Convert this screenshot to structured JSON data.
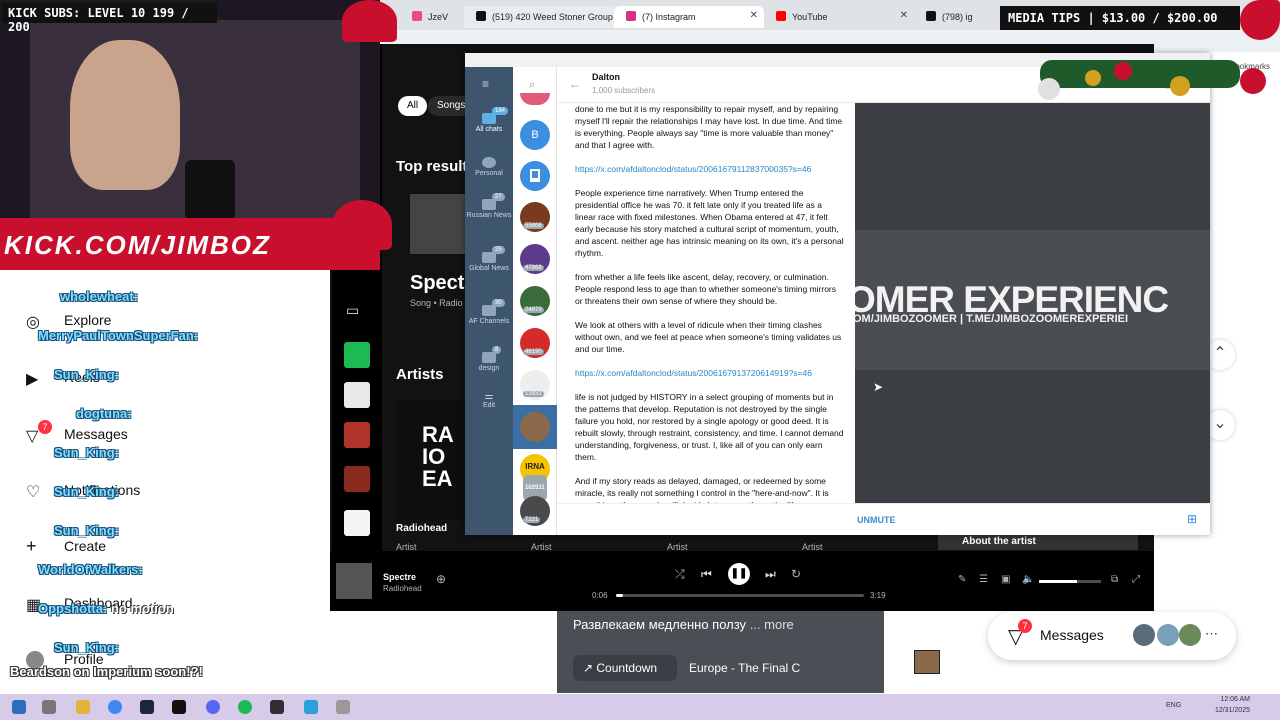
{
  "overlay": {
    "kick_subs": "KICK SUBS: LEVEL 10 199 / 200",
    "media_tips": "MEDIA TIPS | $13.00 / $200.00",
    "banner_url": "KICK.COM/JIMBOZ",
    "chat": [
      {
        "user": "wholewheat:"
      },
      {
        "user": "MerryPaulTownSuperFan:"
      },
      {
        "user": "Sun_King:"
      },
      {
        "user": "dogtuna:"
      },
      {
        "user": "Sun_King:"
      },
      {
        "user": "Sun_King:"
      },
      {
        "user": "Sun_King:"
      },
      {
        "user": "WorldOfWalkers:"
      },
      {
        "user": "Oppshotta:",
        "text": "no motion"
      },
      {
        "user": "Sun_King:"
      },
      {
        "user": "Beardson on Imperium soon!?!"
      }
    ],
    "side_menu": {
      "explore": "Explore",
      "reels": "Reels",
      "messages": "Messages",
      "messages_badge": "7",
      "notifications": "Notifications",
      "create": "Create",
      "dashboard": "Dashboard",
      "profile": "Profile"
    }
  },
  "browser": {
    "tabs": [
      {
        "label": "JzeV",
        "icon_color": "#e94e77"
      },
      {
        "label": "(519) 420 Weed Stoner Group",
        "icon": "x-icon"
      },
      {
        "label": "(7) Instagram",
        "icon": "instagram-icon"
      },
      {
        "label": "YouTube",
        "icon": "youtube-icon"
      },
      {
        "label": "(798) ig",
        "icon": "x-icon"
      }
    ],
    "bookmarks_label": "All Bookmarks"
  },
  "spotify": {
    "chips": [
      "All",
      "Songs"
    ],
    "top_result_heading": "Top result",
    "top_result_title": "Spect",
    "top_result_sub": "Song • Radio",
    "artists_heading": "Artists",
    "artist_card_text": "RA IO EA",
    "artist_name": "Radiohead",
    "artist_labels": [
      "Artist",
      "Artist",
      "Artist",
      "Artist",
      "Artist"
    ],
    "about_artist": "About the artist",
    "player": {
      "track": "Spectre",
      "artist": "Radiohead",
      "elapsed": "0:06",
      "duration": "3:19",
      "progress": 0.03
    }
  },
  "telegram": {
    "channel_name": "Dalton",
    "subscribers": "1,000 subscribers",
    "unmute": "UNMUTE",
    "folders": [
      {
        "label": "All chats",
        "badge": "184"
      },
      {
        "label": "Personal"
      },
      {
        "label": "Russian News",
        "badge": "27"
      },
      {
        "label": "Global News",
        "badge": "25"
      },
      {
        "label": "AF Channels",
        "badge": "30"
      },
      {
        "label": "design",
        "badge": "8"
      },
      {
        "label": "Edit"
      }
    ],
    "chat_badges": [
      "55806",
      "47868",
      "24873",
      "46190",
      "13931",
      "102511",
      "7221"
    ],
    "message": [
      "done to me but it is my responsibility to repair myself, and by repairing myself I'll repair the relationships I may have lost. In due time. And time is everything. People always say \"time is more valuable than money\" and that I agree with.",
      "https://x.com/afdaltonclod/status/2006167911283700035?s=46",
      "People experience time narratively. When Trump entered the presidential office he was 70. it felt late only if you treated life as a linear race with fixed milestones. When Obama entered at 47, it felt early because his story matched a cultural script of momentum, youth, and ascent. neither age has intrinsic meaning on its own, it's a personal rhythm.",
      "from whether a life feels like ascent, delay, recovery, or culmination. People respond less to age than to whether someone's timing mirrors or threatens their own sense of where they should be.",
      "We look at others with a level of ridicule when their timing clashes without own, and we feel at peace when someone's timing validates us and our time.",
      "https://x.com/afdaltonclod/status/2006167913720614919?s=46",
      "life is not judged by HISTORY in a select grouping of moments but in the patterns that develop. Reputation is not destroyed by the single failure you hold, nor restored by a single apology or good deed. It is rebuilt slowly, through restraint, consistency, and time. I cannot demand understanding, forgiveness, or trust. I, like all of you can only earn them.",
      "And if my story reads as delayed, damaged, or redeemed by some miracle, its really not something I control in the \"here-and-now\". It is something other people will decide later, once the entire life"
    ],
    "video_banner": "OMER EXPERIENC",
    "video_sub": "OM/JIMBOZOOMER | T.ME/JIMBOZOOMEREXPERIEI"
  },
  "instagram_panel": {
    "caption": "Развлекаем медленно ползу",
    "more": "... more",
    "link1": "Countdown",
    "link2": "Europe - The Final C",
    "messages_button": "Messages",
    "messages_badge": "7"
  },
  "taskbar": {
    "language": "ENG",
    "time": "12:06 AM",
    "date": "12/31/2025"
  }
}
